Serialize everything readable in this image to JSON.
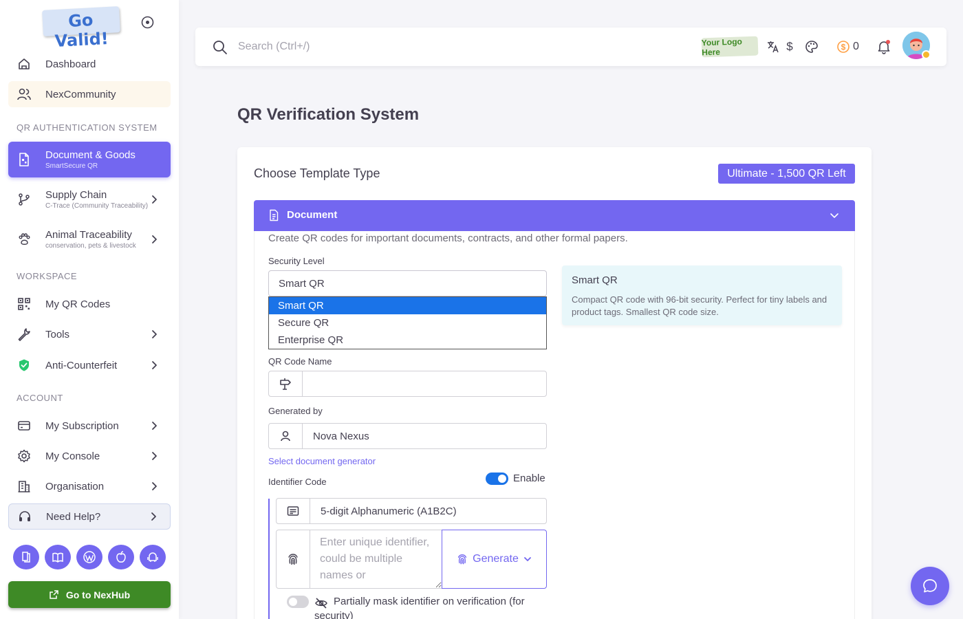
{
  "sidebar": {
    "logo_text": "Go Valid!",
    "nav": {
      "dashboard": "Dashboard",
      "nexcommunity": "NexCommunity",
      "document_goods": {
        "label": "Document & Goods",
        "sub": "SmartSecure QR"
      },
      "supply_chain": {
        "label": "Supply Chain",
        "sub": "C-Trace (Community Traceability)"
      },
      "animal_traceability": {
        "label": "Animal Traceability",
        "sub": "conservation, pets & livestock"
      },
      "my_qr_codes": "My QR Codes",
      "tools": "Tools",
      "anti_counterfeit": "Anti-Counterfeit",
      "my_subscription": "My Subscription",
      "my_console": "My Console",
      "organisation": "Organisation",
      "need_help": "Need Help?"
    },
    "sections": {
      "qr_auth": "QR AUTHENTICATION SYSTEM",
      "workspace": "WORKSPACE",
      "account": "ACCOUNT"
    },
    "go_nexhub": "Go to NexHub",
    "accent": "#7367f0",
    "nexhub_color": "#3e8a26"
  },
  "topbar": {
    "search_placeholder": "Search (Ctrl+/)",
    "your_logo": "Your Logo Here",
    "currency_symbol": "$",
    "coin_count": "0"
  },
  "page": {
    "title": "QR Verification System"
  },
  "card": {
    "title": "Choose Template Type",
    "plan_badge": "Ultimate - 1,500 QR Left",
    "accordion": {
      "title": "Document",
      "description": "Create QR codes for important documents, contracts, and other formal papers."
    },
    "security_level": {
      "label": "Security Level",
      "selected": "Smart QR",
      "options": [
        "Smart QR",
        "Secure QR",
        "Enterprise QR"
      ]
    },
    "info": {
      "title": "Smart QR",
      "text": "Compact QR code with 96-bit security. Perfect for tiny labels and product tags. Smallest QR code size."
    },
    "qr_name": {
      "label": "QR Code Name",
      "value": ""
    },
    "generated_by": {
      "label": "Generated by",
      "value": "Nova Nexus",
      "helper": "Select document generator"
    },
    "identifier": {
      "label": "Identifier Code",
      "toggle_label": "Enable",
      "toggle_on": true,
      "format": "5-digit Alphanumeric (A1B2C)",
      "placeholder": "Enter unique identifier, could be multiple names or",
      "generate": "Generate",
      "mask_label": "Partially mask identifier on verification (for security)",
      "mask_on": false
    }
  }
}
